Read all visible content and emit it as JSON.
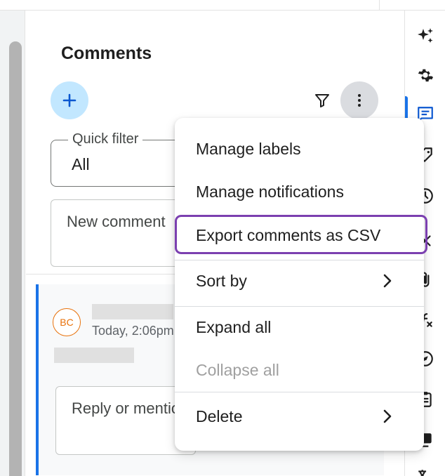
{
  "panel": {
    "title": "Comments"
  },
  "quick_filter": {
    "label": "Quick filter",
    "value": "All"
  },
  "new_comment": {
    "placeholder": "New comment"
  },
  "comment": {
    "avatar_initials": "BC",
    "timestamp": "Today, 2:06pm",
    "reply_placeholder": "Reply or mention"
  },
  "menu": {
    "items": [
      {
        "label": "Manage labels"
      },
      {
        "label": "Manage notifications"
      },
      {
        "label": "Export comments as CSV"
      },
      {
        "label": "Sort by"
      },
      {
        "label": "Expand all"
      },
      {
        "label": "Collapse all"
      },
      {
        "label": "Delete"
      }
    ]
  },
  "colors": {
    "accent": "#1a73e8",
    "add_button": "#c2e7ff",
    "highlight": "#7b3fb0",
    "avatar": "#e8710a"
  },
  "icons": {
    "add": "plus-icon",
    "filter": "filter-icon",
    "more": "more-vert-icon",
    "rail": [
      "sparkle-icon",
      "gear-icon",
      "comment-icon",
      "label-icon",
      "history-icon",
      "close-icon",
      "attachment-icon",
      "function-icon",
      "compass-icon",
      "clipboard-icon",
      "print-icon",
      "translate-icon"
    ]
  }
}
